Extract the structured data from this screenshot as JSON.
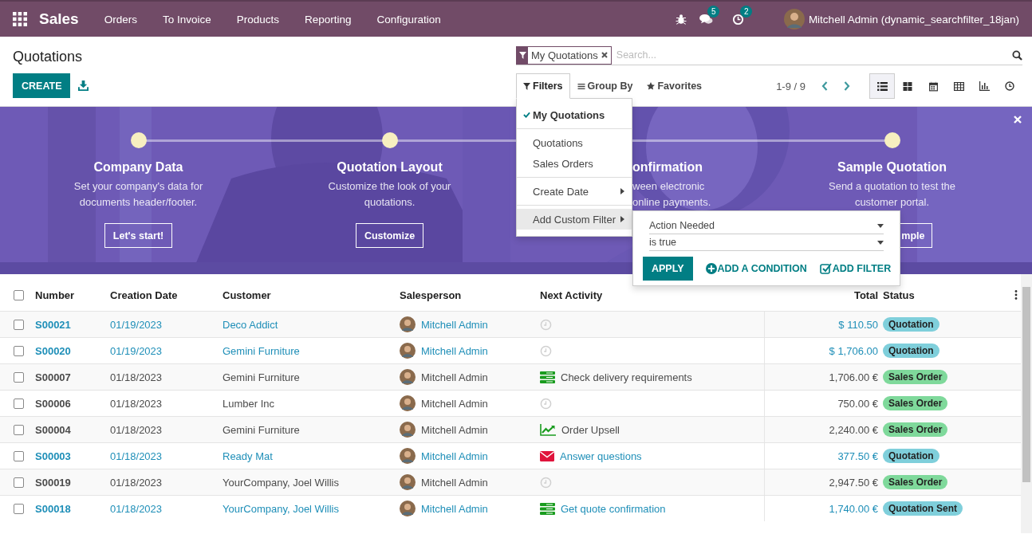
{
  "navbar": {
    "app_name": "Sales",
    "menu": [
      "Orders",
      "To Invoice",
      "Products",
      "Reporting",
      "Configuration"
    ],
    "messages_count": "5",
    "activities_count": "2",
    "user": "Mitchell Admin (dynamic_searchfilter_18jan)"
  },
  "control_panel": {
    "title": "Quotations",
    "create_button": "CREATE",
    "search": {
      "facets": [
        {
          "label": "My Quotations"
        }
      ],
      "placeholder": "Search..."
    },
    "search_tabs": [
      {
        "kind": "filter",
        "label": "Filters",
        "selected": true
      },
      {
        "kind": "group",
        "label": "Group By",
        "selected": false
      },
      {
        "kind": "favorite",
        "label": "Favorites",
        "selected": false
      }
    ],
    "pager": "1-9 / 9",
    "views": [
      {
        "kind": "list",
        "selected": true
      },
      {
        "kind": "kanban",
        "selected": false
      },
      {
        "kind": "calendar",
        "selected": false
      },
      {
        "kind": "pivot",
        "selected": false
      },
      {
        "kind": "graph",
        "selected": false
      },
      {
        "kind": "activity",
        "selected": false
      }
    ]
  },
  "filters_menu": {
    "groups": [
      [
        {
          "kind": "option",
          "label": "My Quotations",
          "checked": true
        }
      ],
      [
        {
          "kind": "option",
          "label": "Quotations",
          "checked": false
        },
        {
          "kind": "option",
          "label": "Sales Orders",
          "checked": false
        }
      ],
      [
        {
          "kind": "submenu",
          "label": "Create Date",
          "expanded": false
        }
      ],
      [
        {
          "kind": "submenu",
          "label": "Add Custom Filter",
          "expanded": true
        }
      ]
    ]
  },
  "custom_filter": {
    "selects": [
      {
        "value": "Action Needed"
      },
      {
        "value": "is true"
      }
    ],
    "apply": "APPLY",
    "add_condition": "ADD A CONDITION",
    "add_filter": "ADD FILTER"
  },
  "banner": {
    "steps": [
      {
        "title": "Company Data",
        "text": "Set your company's data for documents header/footer.",
        "button": "Let's start!"
      },
      {
        "title": "Quotation Layout",
        "text": "Customize the look of your quotations.",
        "button": "Customize"
      },
      {
        "title": "onfirmation",
        "text": "ween electronic online payments."
      },
      {
        "title": "Sample Quotation",
        "text": "Send a quotation to test the customer portal.",
        "button": "mple"
      }
    ]
  },
  "table": {
    "select_all_checked": false,
    "columns": [
      "Number",
      "Creation Date",
      "Customer",
      "Salesperson",
      "Next Activity",
      "Total",
      "Status"
    ],
    "rows": [
      {
        "checked": false,
        "draft": true,
        "number": "S00021",
        "date": "01/19/2023",
        "customer": "Deco Addict",
        "salesperson": "Mitchell Admin",
        "activity": {
          "kind": "none"
        },
        "total": "$ 110.50",
        "status": {
          "label": "Quotation",
          "color": "#7fcfdb"
        }
      },
      {
        "checked": false,
        "draft": true,
        "number": "S00020",
        "date": "01/19/2023",
        "customer": "Gemini Furniture",
        "salesperson": "Mitchell Admin",
        "activity": {
          "kind": "none"
        },
        "total": "$ 1,706.00",
        "status": {
          "label": "Quotation",
          "color": "#7fcfdb"
        }
      },
      {
        "checked": false,
        "draft": false,
        "number": "S00007",
        "date": "01/18/2023",
        "customer": "Gemini Furniture",
        "salesperson": "Mitchell Admin",
        "activity": {
          "kind": "todo",
          "label": "Check delivery requirements"
        },
        "total": "1,706.00 €",
        "status": {
          "label": "Sales Order",
          "color": "#7fd99b"
        }
      },
      {
        "checked": false,
        "draft": false,
        "number": "S00006",
        "date": "01/18/2023",
        "customer": "Lumber Inc",
        "salesperson": "Mitchell Admin",
        "activity": {
          "kind": "none"
        },
        "total": "750.00 €",
        "status": {
          "label": "Sales Order",
          "color": "#7fd99b"
        }
      },
      {
        "checked": false,
        "draft": false,
        "number": "S00004",
        "date": "01/18/2023",
        "customer": "Gemini Furniture",
        "salesperson": "Mitchell Admin",
        "activity": {
          "kind": "upsell",
          "label": "Order Upsell"
        },
        "total": "2,240.00 €",
        "status": {
          "label": "Sales Order",
          "color": "#7fd99b"
        }
      },
      {
        "checked": false,
        "draft": true,
        "number": "S00003",
        "date": "01/18/2023",
        "customer": "Ready Mat",
        "salesperson": "Mitchell Admin",
        "activity": {
          "kind": "email",
          "label": "Answer questions"
        },
        "total": "377.50 €",
        "status": {
          "label": "Quotation",
          "color": "#7fcfdb"
        }
      },
      {
        "checked": false,
        "draft": false,
        "number": "S00019",
        "date": "01/18/2023",
        "customer": "YourCompany, Joel Willis",
        "salesperson": "Mitchell Admin",
        "activity": {
          "kind": "none"
        },
        "total": "2,947.50 €",
        "status": {
          "label": "Sales Order",
          "color": "#7fd99b"
        }
      },
      {
        "checked": false,
        "draft": true,
        "number": "S00018",
        "date": "01/18/2023",
        "customer": "YourCompany, Joel Willis",
        "salesperson": "Mitchell Admin",
        "activity": {
          "kind": "todo",
          "label": "Get quote confirmation"
        },
        "total": "1,740.00 €",
        "status": {
          "label": "Quotation Sent",
          "color": "#7fcfdb"
        }
      }
    ]
  }
}
